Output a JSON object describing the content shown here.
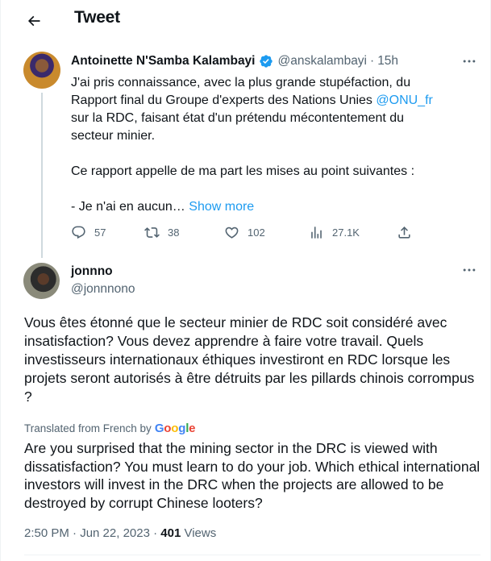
{
  "header": {
    "title": "Tweet",
    "back_icon": "arrow-left-icon"
  },
  "tweet1": {
    "author_name": "Antoinette N'Samba Kalambayi",
    "author_handle": "@anskalambayi",
    "separator": "·",
    "time": "15h",
    "verified_color": "#1d9bf0",
    "lines": [
      "J'ai pris connaissance, avec la plus grande stupéfaction, du",
      "Rapport final du Groupe d'experts des Nations Unies ",
      "sur la RDC, faisant état d'un prétendu mécontentement du",
      "secteur minier."
    ],
    "mention": "@ONU_fr",
    "line5": "Ce rapport appelle de ma part les mises au point suivantes :",
    "line6": "- Je n'ai en aucun…",
    "show_more": "Show more",
    "actions": {
      "replies": "57",
      "retweets": "38",
      "likes": "102",
      "views": "27.1K"
    }
  },
  "tweet2": {
    "author_name": "jonnno",
    "author_handle": "@jonnnono",
    "text": "Vous êtes étonné que le secteur minier de RDC soit considéré avec insatisfaction? Vous devez apprendre à faire votre travail. Quels investisseurs internationaux éthiques investiront en RDC lorsque les projets seront autorisés à être détruits par les pillards chinois corrompus ?",
    "translated_label": "Translated from French by",
    "translator": "Google",
    "translation": "Are you surprised that the mining sector in the DRC is viewed with dissatisfaction? You must learn to do your job. Which ethical international investors will invest in the DRC when the projects are allowed to be destroyed by corrupt Chinese looters?",
    "timestamp": "2:50 PM · Jun 22, 2023",
    "separator": "·",
    "views_count": "401",
    "views_label": "Views"
  }
}
